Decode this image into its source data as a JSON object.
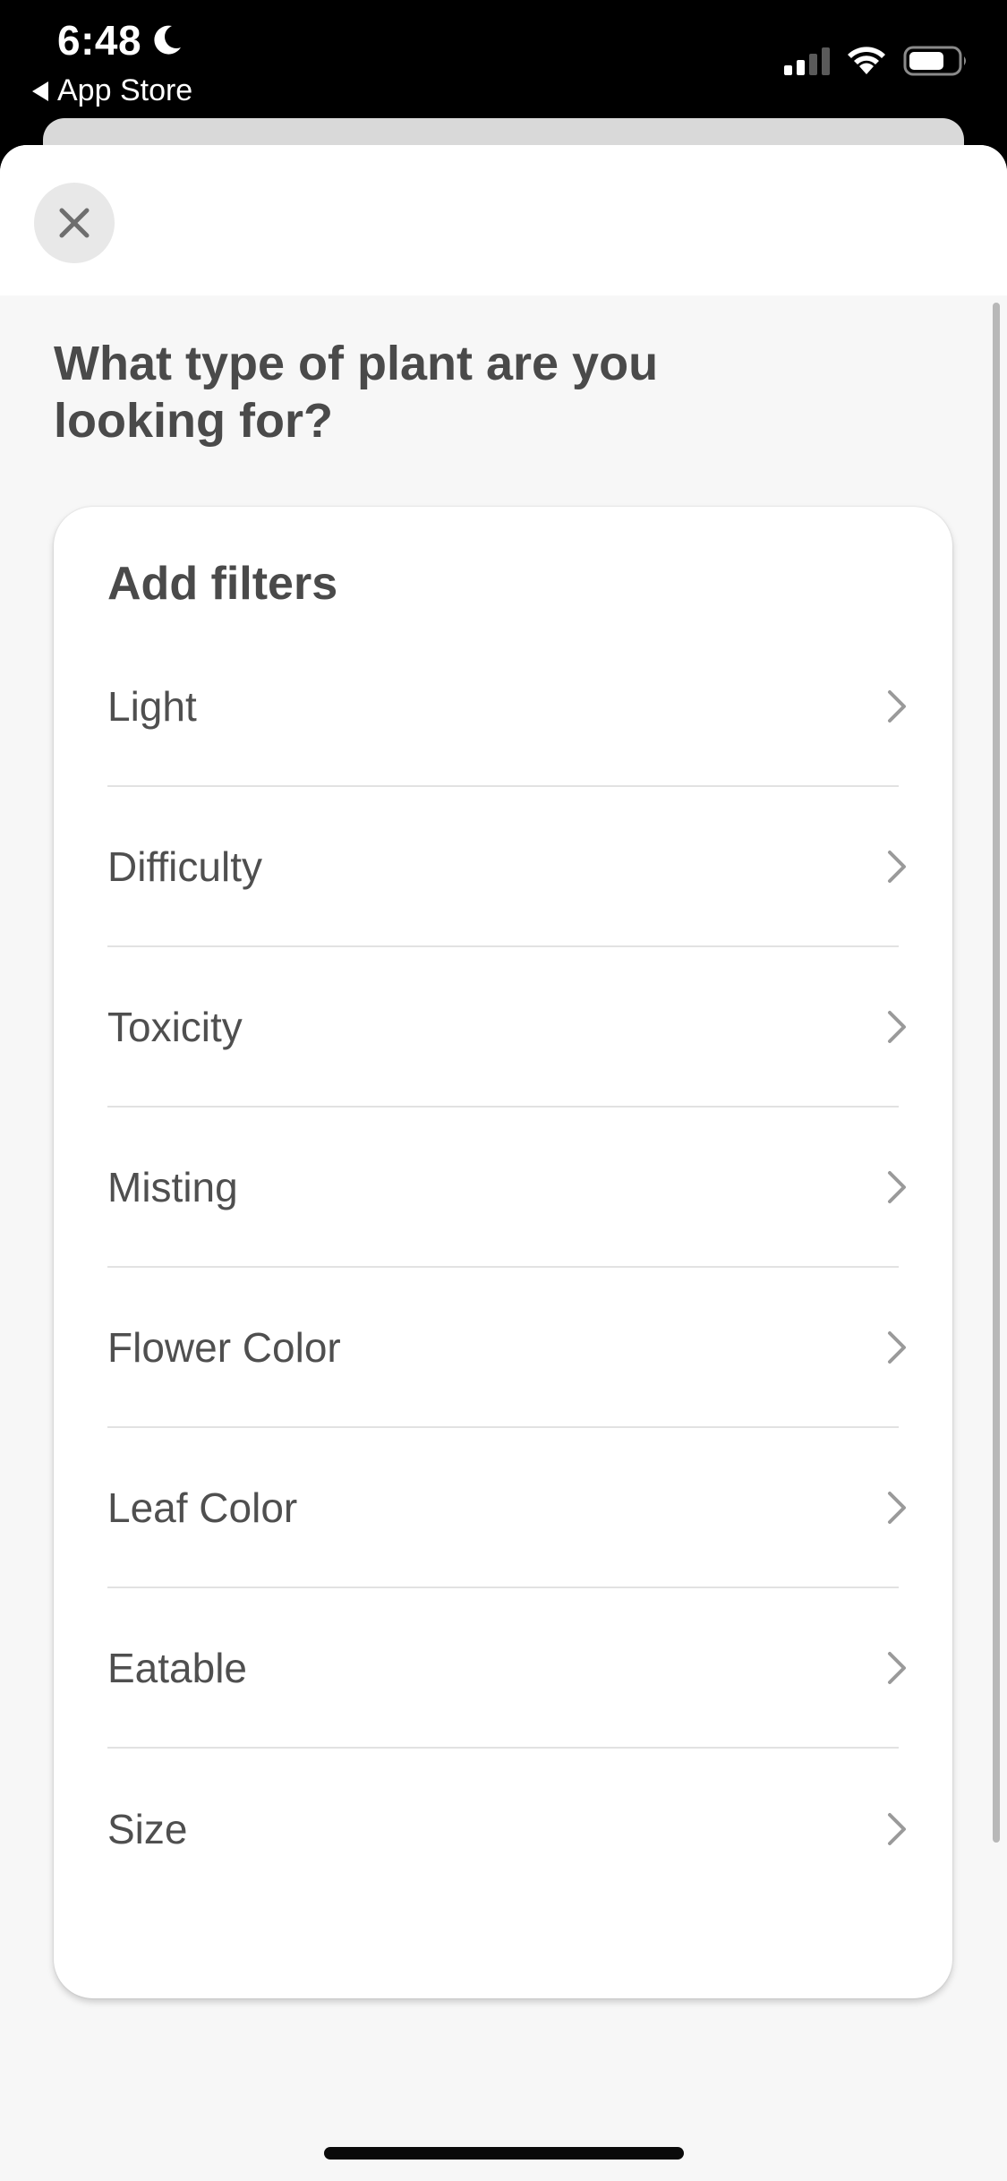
{
  "status_bar": {
    "time": "6:48",
    "back_app_label": "App Store",
    "icons": [
      "moon-icon",
      "cellular-signal-icon",
      "wifi-icon",
      "battery-icon"
    ]
  },
  "sheet": {
    "close_icon": "close-icon",
    "question": "What type of plant are you looking for?",
    "card_title": "Add filters",
    "filters": [
      {
        "label": "Light"
      },
      {
        "label": "Difficulty"
      },
      {
        "label": "Toxicity"
      },
      {
        "label": "Misting"
      },
      {
        "label": "Flower Color"
      },
      {
        "label": "Leaf Color"
      },
      {
        "label": "Eatable"
      },
      {
        "label": "Size"
      }
    ]
  },
  "colors": {
    "status_bar_bg": "#000000",
    "sheet_bg": "#f7f7f7",
    "card_bg": "#ffffff",
    "text": "#4a4a4a",
    "chevron": "#9a9a9a",
    "divider": "#e2e2e2"
  }
}
